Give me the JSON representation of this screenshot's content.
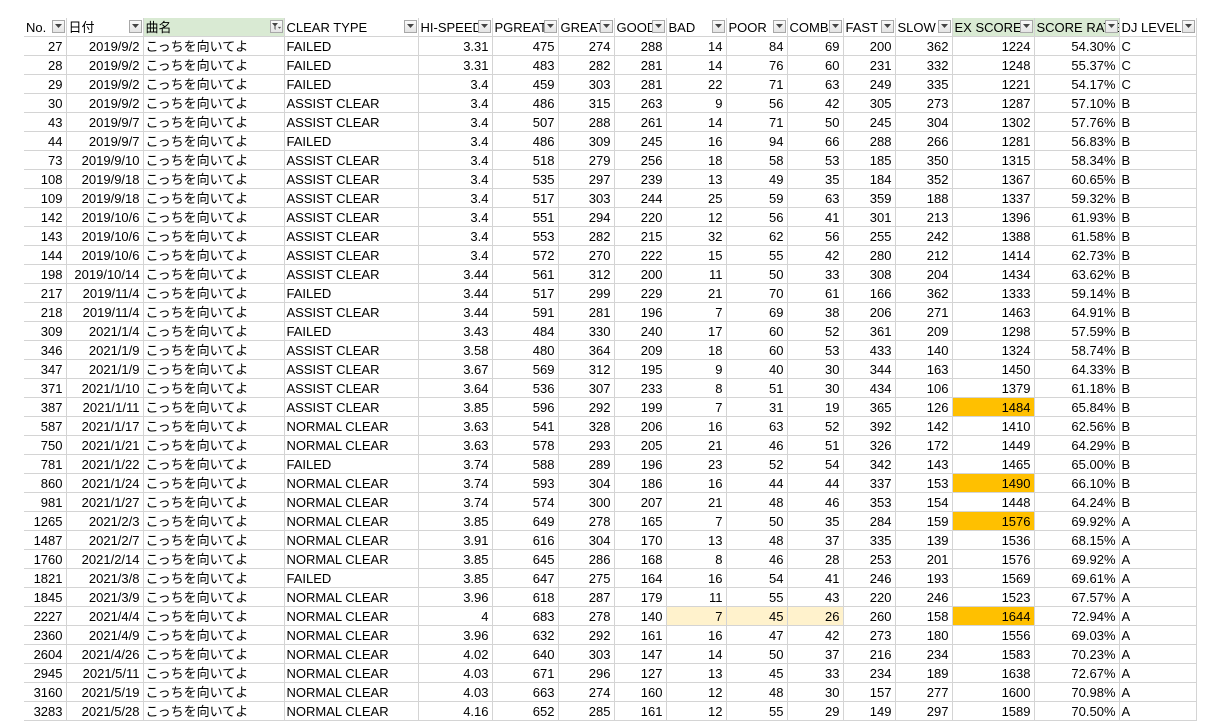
{
  "sheet": {
    "columns": [
      {
        "label": "No.",
        "filter": "dropdown",
        "green": false
      },
      {
        "label": "日付",
        "filter": "dropdown",
        "green": false
      },
      {
        "label": "曲名",
        "filter": "filtered",
        "green": true
      },
      {
        "label": "CLEAR TYPE",
        "filter": "dropdown",
        "green": false
      },
      {
        "label": "HI-SPEED",
        "filter": "dropdown",
        "green": false
      },
      {
        "label": "PGREAT",
        "filter": "dropdown",
        "green": false
      },
      {
        "label": "GREAT",
        "filter": "dropdown",
        "green": false
      },
      {
        "label": "GOOD",
        "filter": "dropdown",
        "green": false
      },
      {
        "label": "BAD",
        "filter": "dropdown",
        "green": false
      },
      {
        "label": "POOR",
        "filter": "dropdown",
        "green": false
      },
      {
        "label": "COMBO",
        "filter": "dropdown",
        "green": false
      },
      {
        "label": "FAST",
        "filter": "dropdown",
        "green": false
      },
      {
        "label": "SLOW",
        "filter": "dropdown",
        "green": false
      },
      {
        "label": "EX SCORE",
        "filter": "dropdown",
        "green": true
      },
      {
        "label": "SCORE RATE",
        "filter": "dropdown",
        "green": true
      },
      {
        "label": "DJ LEVEL",
        "filter": "dropdown",
        "green": false
      }
    ],
    "rows": [
      {
        "cells": [
          "27",
          "2019/9/2",
          "こっちを向いてよ",
          "FAILED",
          "3.31",
          "475",
          "274",
          "288",
          "14",
          "84",
          "69",
          "200",
          "362",
          "1224",
          "54.30%",
          "C"
        ]
      },
      {
        "cells": [
          "28",
          "2019/9/2",
          "こっちを向いてよ",
          "FAILED",
          "3.31",
          "483",
          "282",
          "281",
          "14",
          "76",
          "60",
          "231",
          "332",
          "1248",
          "55.37%",
          "C"
        ]
      },
      {
        "cells": [
          "29",
          "2019/9/2",
          "こっちを向いてよ",
          "FAILED",
          "3.4",
          "459",
          "303",
          "281",
          "22",
          "71",
          "63",
          "249",
          "335",
          "1221",
          "54.17%",
          "C"
        ]
      },
      {
        "cells": [
          "30",
          "2019/9/2",
          "こっちを向いてよ",
          "ASSIST CLEAR",
          "3.4",
          "486",
          "315",
          "263",
          "9",
          "56",
          "42",
          "305",
          "273",
          "1287",
          "57.10%",
          "B"
        ]
      },
      {
        "cells": [
          "43",
          "2019/9/7",
          "こっちを向いてよ",
          "ASSIST CLEAR",
          "3.4",
          "507",
          "288",
          "261",
          "14",
          "71",
          "50",
          "245",
          "304",
          "1302",
          "57.76%",
          "B"
        ]
      },
      {
        "cells": [
          "44",
          "2019/9/7",
          "こっちを向いてよ",
          "FAILED",
          "3.4",
          "486",
          "309",
          "245",
          "16",
          "94",
          "66",
          "288",
          "266",
          "1281",
          "56.83%",
          "B"
        ]
      },
      {
        "cells": [
          "73",
          "2019/9/10",
          "こっちを向いてよ",
          "ASSIST CLEAR",
          "3.4",
          "518",
          "279",
          "256",
          "18",
          "58",
          "53",
          "185",
          "350",
          "1315",
          "58.34%",
          "B"
        ]
      },
      {
        "cells": [
          "108",
          "2019/9/18",
          "こっちを向いてよ",
          "ASSIST CLEAR",
          "3.4",
          "535",
          "297",
          "239",
          "13",
          "49",
          "35",
          "184",
          "352",
          "1367",
          "60.65%",
          "B"
        ]
      },
      {
        "cells": [
          "109",
          "2019/9/18",
          "こっちを向いてよ",
          "ASSIST CLEAR",
          "3.4",
          "517",
          "303",
          "244",
          "25",
          "59",
          "63",
          "359",
          "188",
          "1337",
          "59.32%",
          "B"
        ]
      },
      {
        "cells": [
          "142",
          "2019/10/6",
          "こっちを向いてよ",
          "ASSIST CLEAR",
          "3.4",
          "551",
          "294",
          "220",
          "12",
          "56",
          "41",
          "301",
          "213",
          "1396",
          "61.93%",
          "B"
        ]
      },
      {
        "cells": [
          "143",
          "2019/10/6",
          "こっちを向いてよ",
          "ASSIST CLEAR",
          "3.4",
          "553",
          "282",
          "215",
          "32",
          "62",
          "56",
          "255",
          "242",
          "1388",
          "61.58%",
          "B"
        ]
      },
      {
        "cells": [
          "144",
          "2019/10/6",
          "こっちを向いてよ",
          "ASSIST CLEAR",
          "3.4",
          "572",
          "270",
          "222",
          "15",
          "55",
          "42",
          "280",
          "212",
          "1414",
          "62.73%",
          "B"
        ]
      },
      {
        "cells": [
          "198",
          "2019/10/14",
          "こっちを向いてよ",
          "ASSIST CLEAR",
          "3.44",
          "561",
          "312",
          "200",
          "11",
          "50",
          "33",
          "308",
          "204",
          "1434",
          "63.62%",
          "B"
        ]
      },
      {
        "cells": [
          "217",
          "2019/11/4",
          "こっちを向いてよ",
          "FAILED",
          "3.44",
          "517",
          "299",
          "229",
          "21",
          "70",
          "61",
          "166",
          "362",
          "1333",
          "59.14%",
          "B"
        ]
      },
      {
        "cells": [
          "218",
          "2019/11/4",
          "こっちを向いてよ",
          "ASSIST CLEAR",
          "3.44",
          "591",
          "281",
          "196",
          "7",
          "69",
          "38",
          "206",
          "271",
          "1463",
          "64.91%",
          "B"
        ]
      },
      {
        "cells": [
          "309",
          "2021/1/4",
          "こっちを向いてよ",
          "FAILED",
          "3.43",
          "484",
          "330",
          "240",
          "17",
          "60",
          "52",
          "361",
          "209",
          "1298",
          "57.59%",
          "B"
        ]
      },
      {
        "cells": [
          "346",
          "2021/1/9",
          "こっちを向いてよ",
          "ASSIST CLEAR",
          "3.58",
          "480",
          "364",
          "209",
          "18",
          "60",
          "53",
          "433",
          "140",
          "1324",
          "58.74%",
          "B"
        ]
      },
      {
        "cells": [
          "347",
          "2021/1/9",
          "こっちを向いてよ",
          "ASSIST CLEAR",
          "3.67",
          "569",
          "312",
          "195",
          "9",
          "40",
          "30",
          "344",
          "163",
          "1450",
          "64.33%",
          "B"
        ]
      },
      {
        "cells": [
          "371",
          "2021/1/10",
          "こっちを向いてよ",
          "ASSIST CLEAR",
          "3.64",
          "536",
          "307",
          "233",
          "8",
          "51",
          "30",
          "434",
          "106",
          "1379",
          "61.18%",
          "B"
        ]
      },
      {
        "cells": [
          "387",
          "2021/1/11",
          "こっちを向いてよ",
          "ASSIST CLEAR",
          "3.85",
          "596",
          "292",
          "199",
          "7",
          "31",
          "19",
          "365",
          "126",
          "1484",
          "65.84%",
          "B"
        ],
        "sep": true,
        "hl": {
          "13": "orange"
        }
      },
      {
        "cells": [
          "587",
          "2021/1/17",
          "こっちを向いてよ",
          "NORMAL CLEAR",
          "3.63",
          "541",
          "328",
          "206",
          "16",
          "63",
          "52",
          "392",
          "142",
          "1410",
          "62.56%",
          "B"
        ]
      },
      {
        "cells": [
          "750",
          "2021/1/21",
          "こっちを向いてよ",
          "NORMAL CLEAR",
          "3.63",
          "578",
          "293",
          "205",
          "21",
          "46",
          "51",
          "326",
          "172",
          "1449",
          "64.29%",
          "B"
        ]
      },
      {
        "cells": [
          "781",
          "2021/1/22",
          "こっちを向いてよ",
          "FAILED",
          "3.74",
          "588",
          "289",
          "196",
          "23",
          "52",
          "54",
          "342",
          "143",
          "1465",
          "65.00%",
          "B"
        ]
      },
      {
        "cells": [
          "860",
          "2021/1/24",
          "こっちを向いてよ",
          "NORMAL CLEAR",
          "3.74",
          "593",
          "304",
          "186",
          "16",
          "44",
          "44",
          "337",
          "153",
          "1490",
          "66.10%",
          "B"
        ],
        "hl": {
          "13": "orange"
        }
      },
      {
        "cells": [
          "981",
          "2021/1/27",
          "こっちを向いてよ",
          "NORMAL CLEAR",
          "3.74",
          "574",
          "300",
          "207",
          "21",
          "48",
          "46",
          "353",
          "154",
          "1448",
          "64.24%",
          "B"
        ],
        "sep": true
      },
      {
        "cells": [
          "1265",
          "2021/2/3",
          "こっちを向いてよ",
          "NORMAL CLEAR",
          "3.85",
          "649",
          "278",
          "165",
          "7",
          "50",
          "35",
          "284",
          "159",
          "1576",
          "69.92%",
          "A"
        ],
        "hl": {
          "13": "orange"
        }
      },
      {
        "cells": [
          "1487",
          "2021/2/7",
          "こっちを向いてよ",
          "NORMAL CLEAR",
          "3.91",
          "616",
          "304",
          "170",
          "13",
          "48",
          "37",
          "335",
          "139",
          "1536",
          "68.15%",
          "A"
        ]
      },
      {
        "cells": [
          "1760",
          "2021/2/14",
          "こっちを向いてよ",
          "NORMAL CLEAR",
          "3.85",
          "645",
          "286",
          "168",
          "8",
          "46",
          "28",
          "253",
          "201",
          "1576",
          "69.92%",
          "A"
        ]
      },
      {
        "cells": [
          "1821",
          "2021/3/8",
          "こっちを向いてよ",
          "FAILED",
          "3.85",
          "647",
          "275",
          "164",
          "16",
          "54",
          "41",
          "246",
          "193",
          "1569",
          "69.61%",
          "A"
        ]
      },
      {
        "cells": [
          "1845",
          "2021/3/9",
          "こっちを向いてよ",
          "NORMAL CLEAR",
          "3.96",
          "618",
          "287",
          "179",
          "11",
          "55",
          "43",
          "220",
          "246",
          "1523",
          "67.57%",
          "A"
        ],
        "sep": true
      },
      {
        "cells": [
          "2227",
          "2021/4/4",
          "こっちを向いてよ",
          "NORMAL CLEAR",
          "4",
          "683",
          "278",
          "140",
          "7",
          "45",
          "26",
          "260",
          "158",
          "1644",
          "72.94%",
          "A"
        ],
        "hl": {
          "8": "cream",
          "9": "cream",
          "10": "cream",
          "13": "orange"
        }
      },
      {
        "cells": [
          "2360",
          "2021/4/9",
          "こっちを向いてよ",
          "NORMAL CLEAR",
          "3.96",
          "632",
          "292",
          "161",
          "16",
          "47",
          "42",
          "273",
          "180",
          "1556",
          "69.03%",
          "A"
        ],
        "sep": true
      },
      {
        "cells": [
          "2604",
          "2021/4/26",
          "こっちを向いてよ",
          "NORMAL CLEAR",
          "4.02",
          "640",
          "303",
          "147",
          "14",
          "50",
          "37",
          "216",
          "234",
          "1583",
          "70.23%",
          "A"
        ],
        "sep": true
      },
      {
        "cells": [
          "2945",
          "2021/5/11",
          "こっちを向いてよ",
          "NORMAL CLEAR",
          "4.03",
          "671",
          "296",
          "127",
          "13",
          "45",
          "33",
          "234",
          "189",
          "1638",
          "72.67%",
          "A"
        ]
      },
      {
        "cells": [
          "3160",
          "2021/5/19",
          "こっちを向いてよ",
          "NORMAL CLEAR",
          "4.03",
          "663",
          "274",
          "160",
          "12",
          "48",
          "30",
          "157",
          "277",
          "1600",
          "70.98%",
          "A"
        ],
        "sep": true
      },
      {
        "cells": [
          "3283",
          "2021/5/28",
          "こっちを向いてよ",
          "NORMAL CLEAR",
          "4.16",
          "652",
          "285",
          "161",
          "12",
          "55",
          "29",
          "149",
          "297",
          "1589",
          "70.50%",
          "A"
        ]
      }
    ]
  },
  "colors": {
    "header_green": "#d9ead3",
    "highlight_orange": "#ffc000",
    "highlight_cream": "#fff2cc",
    "separator_green": "#19a35a"
  }
}
